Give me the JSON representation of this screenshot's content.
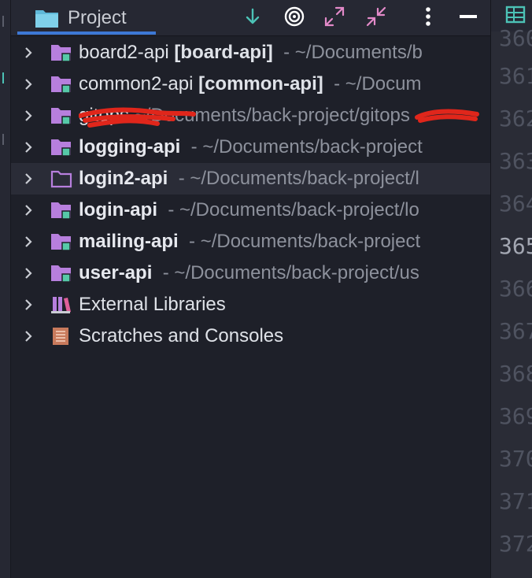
{
  "header": {
    "title": "Project",
    "icons": [
      "scroll-down-icon",
      "target-icon",
      "expand-icon",
      "collapse-icon",
      "more-icon",
      "hide-icon",
      "grid-icon"
    ]
  },
  "tree": {
    "items": [
      {
        "name": "board2-api",
        "module": "[board-api]",
        "path": "- ~/Documents/b",
        "icon": "module-folder-icon",
        "bold": false
      },
      {
        "name": "common2-api",
        "module": "[common-api]",
        "path": "- ~/Docum",
        "icon": "module-folder-icon",
        "bold": false
      },
      {
        "name": "gitops",
        "module": "",
        "path": "~/Documents/back-project/gitops",
        "icon": "module-folder-icon",
        "bold": false,
        "redacted": true
      },
      {
        "name": "logging-api",
        "module": "",
        "path": "- ~/Documents/back-project",
        "icon": "module-folder-icon",
        "bold": true
      },
      {
        "name": "login2-api",
        "module": "",
        "path": "- ~/Documents/back-project/l",
        "icon": "folder-outline-icon",
        "bold": true,
        "selected": true
      },
      {
        "name": "login-api",
        "module": "",
        "path": "- ~/Documents/back-project/lo",
        "icon": "module-folder-icon",
        "bold": true
      },
      {
        "name": "mailing-api",
        "module": "",
        "path": "- ~/Documents/back-project",
        "icon": "module-folder-icon",
        "bold": true
      },
      {
        "name": "user-api",
        "module": "",
        "path": "- ~/Documents/back-project/us",
        "icon": "module-folder-icon",
        "bold": true
      },
      {
        "name": "External Libraries",
        "module": "",
        "path": "",
        "icon": "library-icon",
        "bold": false
      },
      {
        "name": "Scratches and Consoles",
        "module": "",
        "path": "",
        "icon": "scratches-icon",
        "bold": false
      }
    ]
  },
  "gutter": {
    "line_numbers": [
      "360",
      "361",
      "362",
      "363",
      "364",
      "365",
      "366",
      "367",
      "368",
      "369",
      "370",
      "371",
      "372"
    ],
    "current_line": "365"
  },
  "colors": {
    "accent_teal": "#4cc2b6",
    "folder_purple": "#b77fdd",
    "selection_underline": "#3d78d6",
    "redaction_red": "#e0261b"
  }
}
